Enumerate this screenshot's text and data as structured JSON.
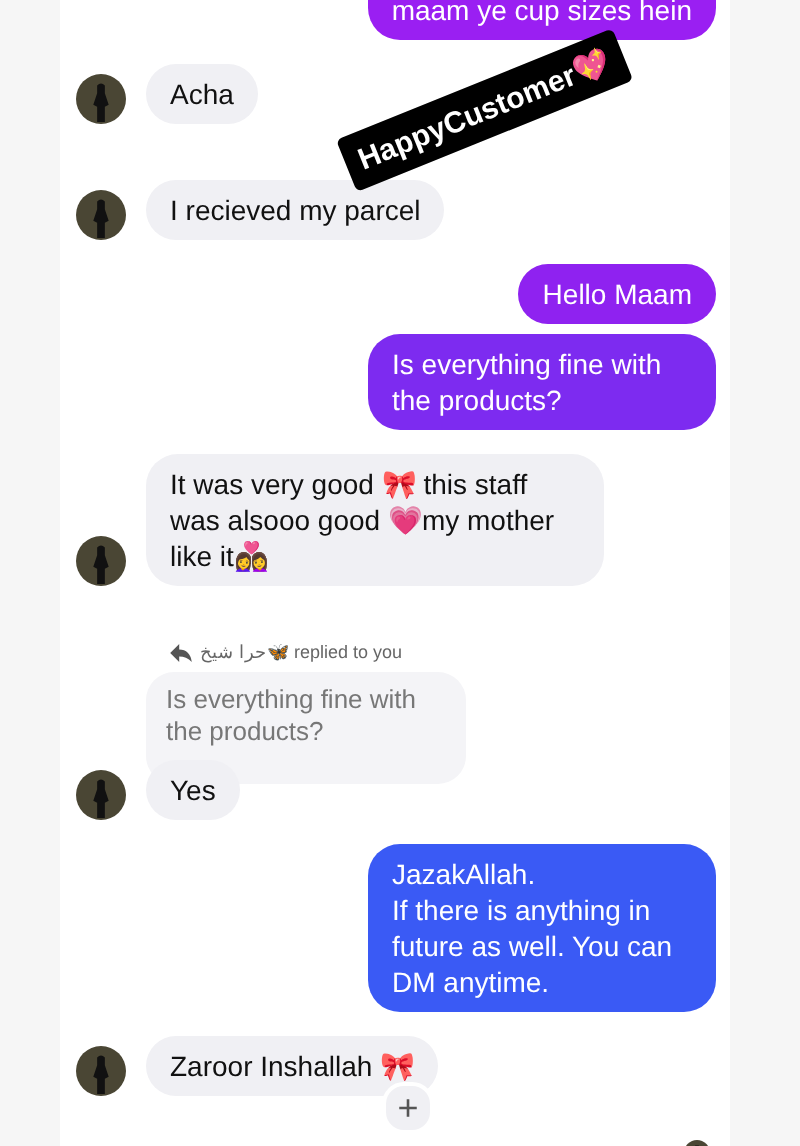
{
  "messages": [
    {
      "kind": "outgoing",
      "text": "maam ye cup sizes hein",
      "color": "#9a1ff2"
    },
    {
      "kind": "incoming",
      "text": "Acha"
    },
    {
      "kind": "incoming",
      "text": "I recieved my parcel"
    },
    {
      "kind": "outgoing",
      "text": "Hello Maam",
      "color": "#8f22f0"
    },
    {
      "kind": "outgoing",
      "text": "Is everything fine with the products?",
      "color": "#7d2bf0"
    },
    {
      "kind": "incoming",
      "text": "It was very good 🎀 this staff was alsooo good 💗my mother like it👩‍❤️‍👩"
    },
    {
      "kind": "reply-note",
      "sender": "حرا شیخ🦋",
      "text": "replied to you"
    },
    {
      "kind": "quoted",
      "text": "Is everything fine with the products?"
    },
    {
      "kind": "incoming",
      "text": "Yes"
    },
    {
      "kind": "outgoing",
      "text": "JazakAllah.\nIf there is anything in future as well. You can DM anytime.",
      "color": "#3a5af5"
    },
    {
      "kind": "incoming",
      "text": "Zaroor Inshallah 🎀",
      "reaction": "+"
    }
  ],
  "sticker": {
    "text": "HappyCustomer💖"
  }
}
